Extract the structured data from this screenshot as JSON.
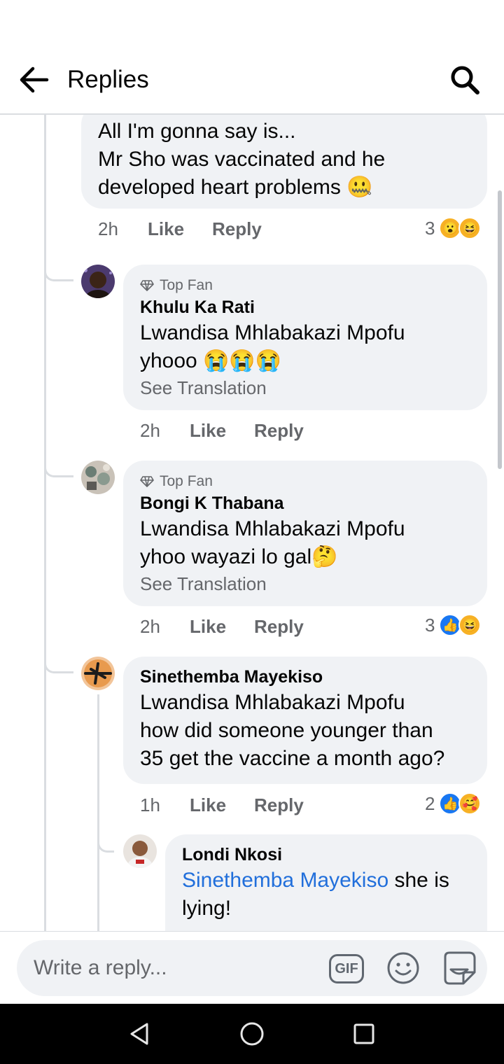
{
  "header": {
    "title": "Replies",
    "back_icon": "arrow-left-icon",
    "search_icon": "search-icon"
  },
  "comments": [
    {
      "lines": [
        "All I'm gonna say is...",
        "Mr Sho was vaccinated and he",
        "developed heart problems 🤐"
      ],
      "time": "2h",
      "like": "Like",
      "reply": "Reply",
      "reaction_count": "3",
      "reactions": [
        "😮",
        "😆"
      ]
    },
    {
      "badge": "Top Fan",
      "author": "Khulu Ka Rati",
      "mention": "Lwandisa Mhlabakazi Mpofu",
      "text": "yhooo 😭😭😭",
      "see_translation": "See Translation",
      "time": "2h",
      "like": "Like",
      "reply": "Reply"
    },
    {
      "badge": "Top Fan",
      "author": "Bongi K Thabana",
      "mention": "Lwandisa Mhlabakazi Mpofu",
      "text": "yhoo wayazi lo gal🤔",
      "see_translation": "See Translation",
      "time": "2h",
      "like": "Like",
      "reply": "Reply",
      "reaction_count": "3",
      "reactions": [
        "👍",
        "😆"
      ]
    },
    {
      "author": "Sinethemba Mayekiso",
      "mention": "Lwandisa Mhlabakazi Mpofu",
      "lines": [
        "how did someone younger than",
        "35 get the vaccine a month ago?"
      ],
      "time": "1h",
      "like": "Like",
      "reply": "Reply",
      "reaction_count": "2",
      "reactions": [
        "👍",
        "🥰"
      ]
    },
    {
      "author": "Londi Nkosi",
      "mention": "Sinethemba Mayekiso",
      "text_after_mention": " she is",
      "line2": "lying!"
    }
  ],
  "composer": {
    "placeholder": "Write a reply...",
    "gif_label": "GIF"
  },
  "colors": {
    "mention": "#216fdb",
    "bubble": "#f0f2f5",
    "muted": "#65676b",
    "like_blue": "#1877f2"
  }
}
